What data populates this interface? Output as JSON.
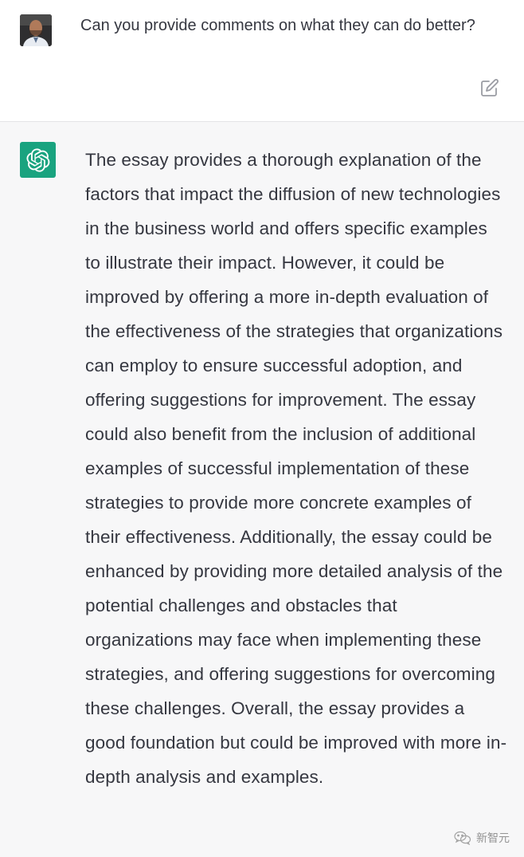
{
  "user_message": {
    "text": "Can you provide comments on what they can do better?",
    "edit_icon": "edit-icon"
  },
  "assistant_message": {
    "avatar_icon": "openai-logo-icon",
    "text": "The essay provides a thorough explanation of the factors that impact the diffusion of new technologies in the business world and offers specific examples to illustrate their impact. However, it could be improved by offering a more in-depth evaluation of the effectiveness of the strategies that organizations can employ to ensure successful adoption, and offering suggestions for improvement. The essay could also benefit from the inclusion of additional examples of successful implementation of these strategies to provide more concrete examples of their effectiveness. Additionally, the essay could be enhanced by providing more detailed analysis of the potential challenges and obstacles that organizations may face when implementing these strategies, and offering suggestions for overcoming these challenges. Overall, the essay provides a good foundation but could be improved with more in-depth analysis and examples."
  },
  "watermark": {
    "icon": "wechat-icon",
    "text": "新智元"
  },
  "colors": {
    "accent": "#19a37f",
    "assistant_bg": "#f7f7f8",
    "text": "#353740"
  }
}
